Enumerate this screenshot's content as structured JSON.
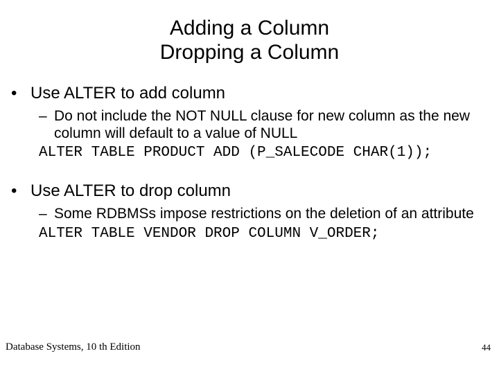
{
  "title_line1": "Adding a Column",
  "title_line2": "Dropping a Column",
  "section1": {
    "bullet": "Use ALTER to add column",
    "sub": "Do not include the NOT NULL clause for new column as the new column will default to a value of NULL",
    "code": "ALTER TABLE PRODUCT ADD (P_SALECODE CHAR(1));"
  },
  "section2": {
    "bullet": "Use ALTER to drop column",
    "sub": "Some RDBMSs impose restrictions on the deletion of an attribute",
    "code": "ALTER TABLE VENDOR DROP COLUMN V_ORDER;"
  },
  "footer": "Database Systems, 10 th Edition",
  "page_number": "44",
  "marks": {
    "bullet": "•",
    "dash": "–"
  }
}
